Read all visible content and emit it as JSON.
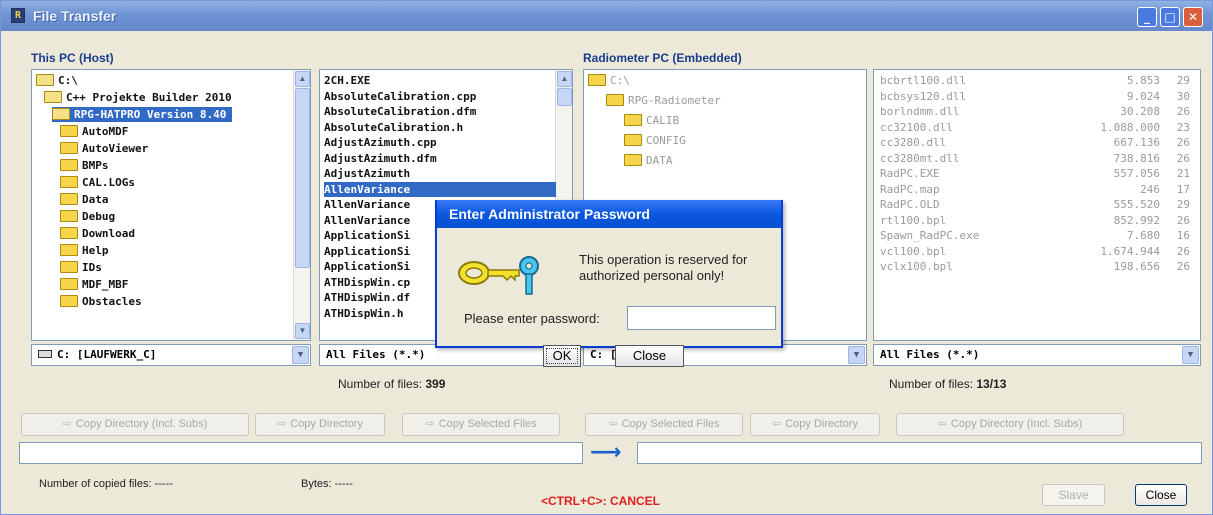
{
  "window": {
    "title": "File Transfer"
  },
  "host": {
    "section_title": "This PC (Host)",
    "tree": [
      {
        "label": "C:\\",
        "open": true,
        "indent": 0
      },
      {
        "label": "C++ Projekte Builder 2010",
        "open": true,
        "indent": 1
      },
      {
        "label": "RPG-HATPRO Version 8.40",
        "open": true,
        "indent": 2,
        "selected": true
      },
      {
        "label": "AutoMDF",
        "indent": 3
      },
      {
        "label": "AutoViewer",
        "indent": 3
      },
      {
        "label": "BMPs",
        "indent": 3
      },
      {
        "label": "CAL.LOGs",
        "indent": 3
      },
      {
        "label": "Data",
        "indent": 3
      },
      {
        "label": "Debug",
        "indent": 3
      },
      {
        "label": "Download",
        "indent": 3
      },
      {
        "label": "Help",
        "indent": 3
      },
      {
        "label": "IDs",
        "indent": 3
      },
      {
        "label": "MDF_MBF",
        "indent": 3
      },
      {
        "label": "Obstacles",
        "indent": 3
      }
    ],
    "files": [
      "2CH.EXE",
      "AbsoluteCalibration.cpp",
      "AbsoluteCalibration.dfm",
      "AbsoluteCalibration.h",
      "AdjustAzimuth.cpp",
      "AdjustAzimuth.dfm",
      "AdjustAzimuth",
      "AllenVariance",
      "AllenVariance",
      "AllenVariance",
      "ApplicationSi",
      "ApplicationSi",
      "ApplicationSi",
      "ATHDispWin.cp",
      "ATHDispWin.df",
      "ATHDispWin.h"
    ],
    "selected_file_index": 7,
    "drive": "C: [LAUFWERK_C]",
    "filter": "All Files (*.*)",
    "count_label": "Number of files:",
    "count_value": "399"
  },
  "remote": {
    "section_title": "Radiometer PC (Embedded)",
    "tree": [
      {
        "label": "C:\\",
        "indent": 0
      },
      {
        "label": "RPG-Radiometer",
        "indent": 1
      },
      {
        "label": "CALIB",
        "indent": 2
      },
      {
        "label": "CONFIG",
        "indent": 2
      },
      {
        "label": "DATA",
        "indent": 2
      }
    ],
    "files": [
      {
        "name": "bcbrtl100.dll",
        "size": "5.853",
        "n": "29"
      },
      {
        "name": "bcbsys120.dll",
        "size": "9.024",
        "n": "30"
      },
      {
        "name": "borlndmm.dll",
        "size": "30.208",
        "n": "26"
      },
      {
        "name": "cc32100.dll",
        "size": "1.088.000",
        "n": "23"
      },
      {
        "name": "cc3280.dll",
        "size": "667.136",
        "n": "26"
      },
      {
        "name": "cc3280mt.dll",
        "size": "738.816",
        "n": "26"
      },
      {
        "name": "RadPC.EXE",
        "size": "557.056",
        "n": "21"
      },
      {
        "name": "RadPC.map",
        "size": "246",
        "n": "17"
      },
      {
        "name": "RadPC.OLD",
        "size": "555.520",
        "n": "29"
      },
      {
        "name": "rtl100.bpl",
        "size": "852.992",
        "n": "26"
      },
      {
        "name": "Spawn_RadPC.exe",
        "size": "7.680",
        "n": "16"
      },
      {
        "name": "vcl100.bpl",
        "size": "1.674.944",
        "n": "26"
      },
      {
        "name": "vclx100.bpl",
        "size": "198.656",
        "n": "26"
      }
    ],
    "drive": "C: [SYSTEM]",
    "filter": "All Files (*.*)",
    "count_label": "Number of files:",
    "count_value": "13/13"
  },
  "copy_buttons": [
    "Copy Directory (Incl. Subs)",
    "Copy Directory",
    "Copy Selected Files",
    "Copy Selected Files",
    "Copy Directory",
    "Copy Directory (Incl. Subs)"
  ],
  "status": {
    "copied_label": "Number of copied files:",
    "copied_value": "-----",
    "bytes_label": "Bytes:",
    "bytes_value": "-----",
    "cancel_hint": "<CTRL+C>: CANCEL",
    "slave_label": "Slave",
    "close_label": "Close"
  },
  "dialog": {
    "title": "Enter Administrator Password",
    "message": "This operation is reserved for authorized personal only!",
    "password_label": "Please  enter password:",
    "password_value": "",
    "ok_label": "OK",
    "close_label": "Close"
  }
}
